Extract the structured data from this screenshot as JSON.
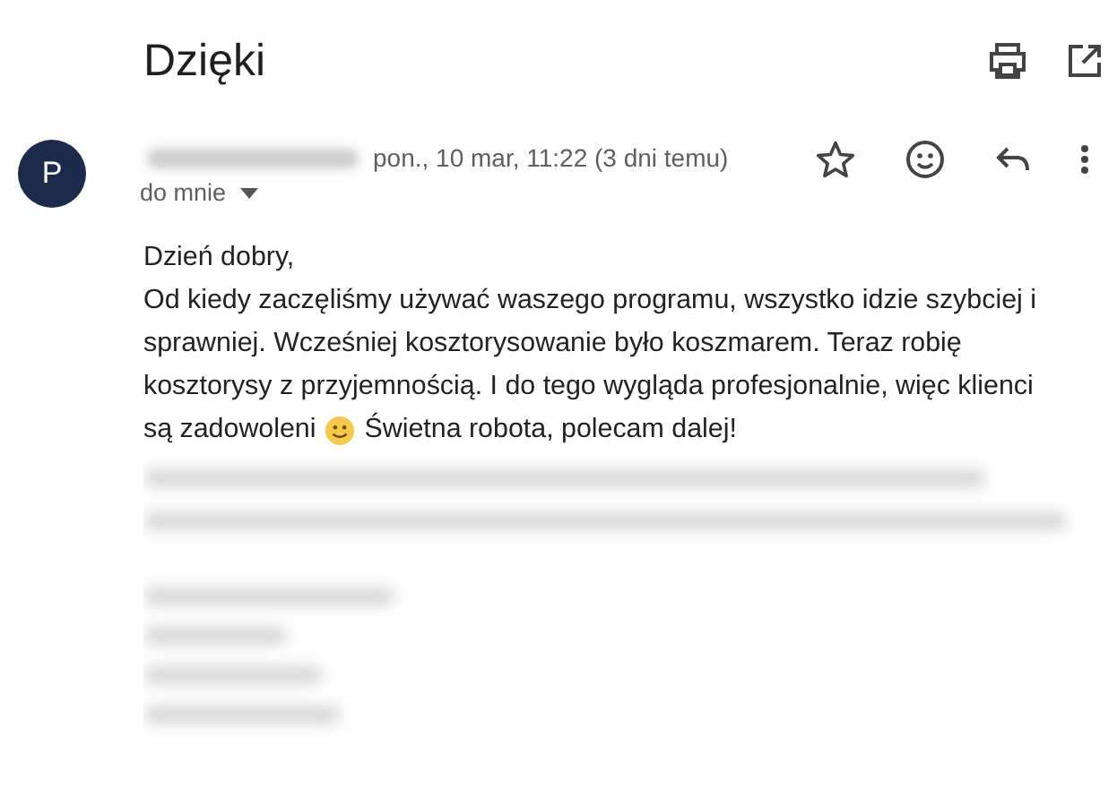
{
  "subject": "Dzięki",
  "sender": {
    "avatar_letter": "P",
    "date": "pon., 10 mar, 11:22 (3 dni temu)",
    "recipient": "do mnie",
    "starred": false
  },
  "body": {
    "greeting": "Dzień dobry,",
    "lines": [
      "Od kiedy zaczęliśmy używać waszego programu, wszystko idzie szybciej i",
      "sprawniej. Wcześniej kosztorysowanie było koszmarem. Teraz robię",
      "kosztorysy z przyjemnością. I do tego wygląda profesjonalnie, więc klienci"
    ],
    "last_line_before": "są zadowoleni",
    "last_line_after": "Świetna robota, polecam dalej!"
  }
}
